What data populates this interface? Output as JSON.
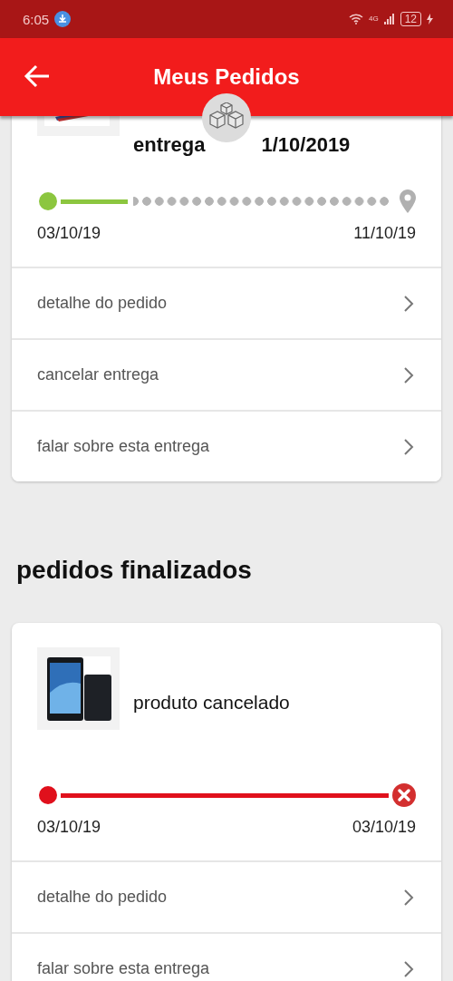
{
  "status_bar": {
    "time": "6:05",
    "network": "4G",
    "battery": "12"
  },
  "app_bar": {
    "title": "Meus Pedidos"
  },
  "orders": [
    {
      "kind": "in_transit",
      "image": {
        "kind": "picture"
      },
      "title_parts": [
        "entrega",
        "1/10/2019"
      ],
      "progress": {
        "level": 0.22,
        "start_date": "03/10/19",
        "end_date": "11/10/19"
      },
      "actions": [
        "detalhe do pedido",
        "cancelar entrega",
        "falar sobre esta entrega"
      ]
    }
  ],
  "finished_heading": "pedidos finalizados",
  "finished_orders": [
    {
      "kind": "cancelled",
      "image": {
        "kind": "picture"
      },
      "title_parts": [
        "produto cancelado"
      ],
      "progress": {
        "start_date": "03/10/19",
        "end_date": "03/10/19"
      },
      "actions": [
        "detalhe do pedido",
        "falar sobre esta entrega"
      ]
    }
  ]
}
